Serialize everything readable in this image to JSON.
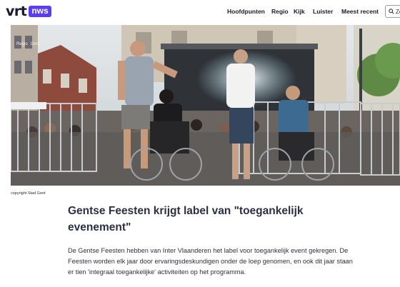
{
  "header": {
    "logo_text": "vrt",
    "logo_badge": "nws",
    "nav": [
      "Hoofdpunten",
      "Regio",
      "Kijk",
      "Luister",
      "Meest recent"
    ],
    "search_label": "Zo",
    "brand_color": "#5c3df5"
  },
  "hero": {
    "breadcrumb": [
      "Regio",
      "Gent"
    ],
    "caption": "copyright Stad Gent"
  },
  "article": {
    "title": "Gentse Feesten krijgt label van \"toegankelijk evenement\"",
    "lead": "De Gentse Feesten hebben van Inter Vlaanderen het label voor toegankelijk event gekregen. De Feesten worden elk jaar door ervaringsdeskundigen onder de loep genomen, en ook dit jaar staan er tien 'integraal toegankelijke' activiteiten op het programma."
  }
}
